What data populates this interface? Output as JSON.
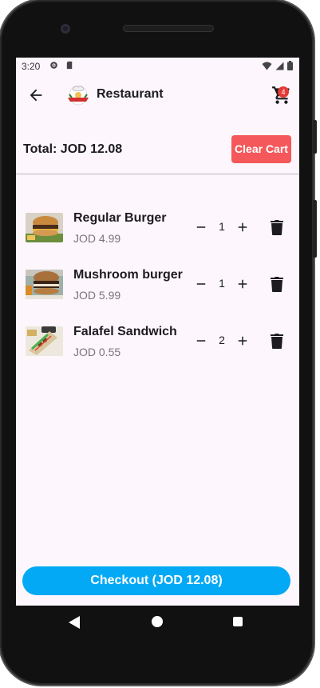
{
  "status_bar": {
    "time": "3:20",
    "icons": [
      "settings-icon",
      "sd-card-icon",
      "wifi-icon",
      "signal-icon",
      "battery-icon"
    ]
  },
  "app_bar": {
    "title": "Restaurant",
    "cart_count": "4"
  },
  "cart": {
    "total_label": "Total: JOD 12.08",
    "clear_label": "Clear Cart",
    "items": [
      {
        "name": "Regular Burger",
        "price": "JOD 4.99",
        "qty": "1"
      },
      {
        "name": "Mushroom burger",
        "price": "JOD 5.99",
        "qty": "1"
      },
      {
        "name": "Falafel Sandwich",
        "price": "JOD 0.55",
        "qty": "2"
      }
    ],
    "checkout_label": "Checkout (JOD 12.08)"
  },
  "colors": {
    "screen_bg": "#fdf6fd",
    "clear_button": "#f4585a",
    "checkout_button": "#03a9f4",
    "badge": "#e53935"
  }
}
